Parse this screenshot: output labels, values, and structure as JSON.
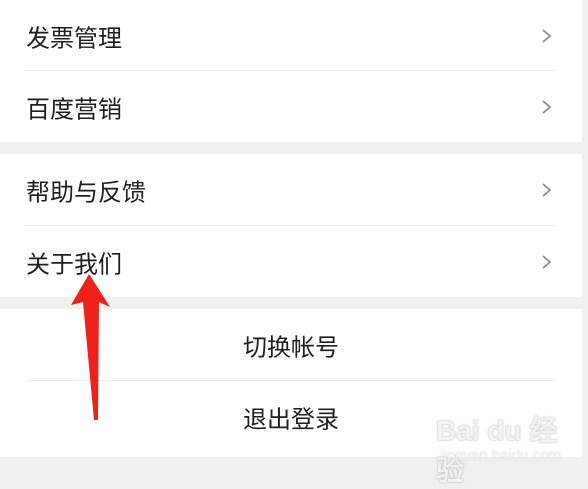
{
  "menu_group_1": {
    "items": [
      {
        "label": "发票管理"
      },
      {
        "label": "百度营销"
      }
    ]
  },
  "menu_group_2": {
    "items": [
      {
        "label": "帮助与反馈"
      },
      {
        "label": "关于我们"
      }
    ]
  },
  "account_group": {
    "switch_account_label": "切换帐号",
    "logout_label": "退出登录"
  },
  "annotation": {
    "arrow_color": "#f0201b"
  },
  "watermark": {
    "brand": "Bai du 经验",
    "url": "jingyan.baidu.com"
  },
  "colors": {
    "background": "#f0f0f0",
    "card": "#ffffff",
    "text": "#1f1f1f",
    "chevron": "#8c8c8c"
  }
}
